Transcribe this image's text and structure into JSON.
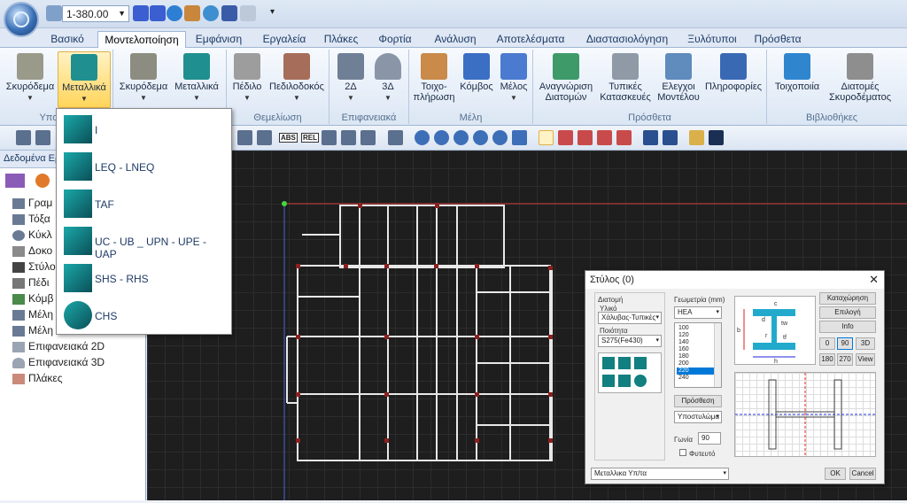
{
  "titlebar": {
    "scale_value": "1-380.00"
  },
  "tabs": [
    "Βασικό",
    "Μοντελοποίηση",
    "Εμφάνιση",
    "Εργαλεία",
    "Πλάκες",
    "Φορτία",
    "Ανάλυση",
    "Αποτελέσματα",
    "Διαστασιολόγηση",
    "Ξυλότυποι",
    "Πρόσθετα"
  ],
  "active_tab": "Μοντελοποίηση",
  "ribbon": {
    "groups": [
      {
        "label": "Υποστυ",
        "buttons": [
          "Σκυρόδεμα",
          "Μεταλλικά"
        ]
      },
      {
        "label": "",
        "buttons": [
          "Σκυρόδεμα",
          "Μεταλλικά"
        ]
      },
      {
        "label": "Θεμελίωση",
        "buttons": [
          "Πέδιλο",
          "Πεδιλοδοκός"
        ]
      },
      {
        "label": "Επιφανειακά",
        "buttons": [
          "2Δ",
          "3Δ"
        ]
      },
      {
        "label": "Μέλη",
        "buttons": [
          "Τοιχο-\nπλήρωση",
          "Κόμβος",
          "Μέλος"
        ]
      },
      {
        "label": "Πρόσθετα",
        "buttons": [
          "Αναγνώριση\nΔιατομών",
          "Τυπικές\nΚατασκευές",
          "Ελεγχοι\nΜοντέλου",
          "Πληροφορίες"
        ]
      },
      {
        "label": "Βιβλιοθήκες",
        "buttons": [
          "Τοιχοποιία",
          "Διατομές\nΣκυροδέματος"
        ]
      }
    ]
  },
  "toolbar2": {
    "abs_label": "ABS",
    "rel_label": "REL"
  },
  "leftpanel": {
    "header": "Δεδομένα Ερ",
    "tree": [
      "Γραμ",
      "Τόξα",
      "Κύκλ",
      "Δοκο",
      "Στύλο",
      "Πέδι",
      "Κόμβ",
      "Μέλη",
      "Μέλη",
      "Επιφανειακά 2D",
      "Επιφανειακά 3D",
      "Πλάκες"
    ]
  },
  "dropdown_menu": {
    "items": [
      "I",
      "LEQ - LNEQ",
      "TAF",
      "UC - UB _ UPN - UPE - UAP",
      "SHS - RHS",
      "CHS"
    ]
  },
  "dialog": {
    "title": "Στύλος (0)",
    "section_label": "Διατομή",
    "material_label": "Υλικό",
    "material_value": "Χάλυβας-Τυπικές",
    "quality_label": "Ποιότητα",
    "quality_value": "S275(Fe430)",
    "geometry_label": "Γεωμετρία (mm)",
    "profile_value": "HEA",
    "sizes": [
      "100",
      "120",
      "140",
      "160",
      "180",
      "200",
      "220",
      "240"
    ],
    "selected_size": "220",
    "add_button": "Πρόσθεση",
    "type_value": "Υποστυλώμα",
    "angle_label": "Γωνία",
    "angle_value": "90",
    "planted_label": "Φυτευτό",
    "bottom_select": "Μεταλλικα Υπ/τα",
    "register_button": "Καταχώρηση",
    "select_button": "Επιλογή",
    "info_button": "Info",
    "angle_buttons": [
      "0",
      "90",
      "3D",
      "180",
      "270",
      "View"
    ],
    "ok_button": "OK",
    "cancel_button": "Cancel",
    "diagram_labels": [
      "c",
      "d",
      "tw",
      "b",
      "r",
      "tf",
      "h"
    ]
  }
}
